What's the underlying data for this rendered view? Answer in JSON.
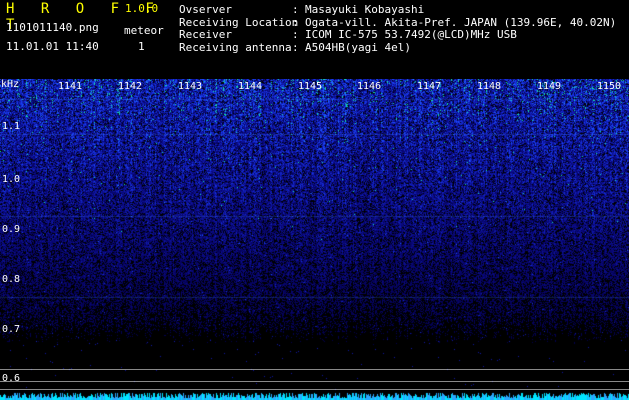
{
  "app": {
    "title": "H R O F F T",
    "version": "1.0.0"
  },
  "file": {
    "name": "1101011140.png",
    "datetime": "11.01.01 11:40"
  },
  "meteor": {
    "label": "meteor",
    "count": "1"
  },
  "info": [
    {
      "key": "Ovserver",
      "value": "Masayuki Kobayashi"
    },
    {
      "key": "Receiving Location",
      "value": "Ogata-vill. Akita-Pref. JAPAN (139.96E, 40.02N)"
    },
    {
      "key": "Receiver",
      "value": "ICOM IC-575 53.7492(@LCD)MHz USB"
    },
    {
      "key": "Receiving antenna",
      "value": "A504HB(yagi 4el)"
    }
  ],
  "spectrogram": {
    "unit_label": "kHz",
    "y_ticks": [
      "1.1",
      "1.0",
      "0.9",
      "0.8",
      "0.7",
      "0.6"
    ],
    "x_ticks": [
      "1141",
      "1142",
      "1143",
      "1144",
      "1145",
      "1146",
      "1147",
      "1148",
      "1149",
      "1150"
    ],
    "colors": {
      "background": "#000000",
      "signal": "#1a3cff",
      "strong_signal": "#00ffb4",
      "text": "#ffffff",
      "title": "#ffff00"
    }
  }
}
